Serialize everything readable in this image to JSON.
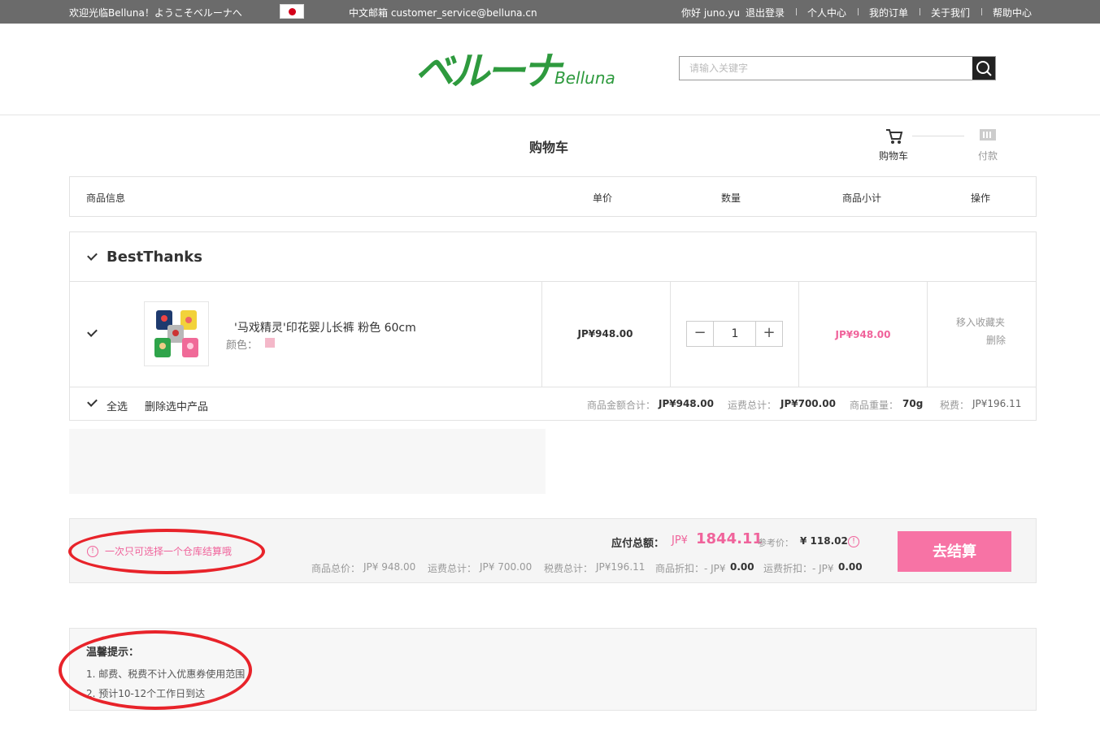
{
  "topbar": {
    "welcome": "欢迎光临Belluna！ようこそベルーナへ",
    "email": "中文邮箱 customer_service@belluna.cn",
    "greeting": "你好 juno.yu",
    "logout": "退出登录",
    "personal_center": "个人中心",
    "my_orders": "我的订单",
    "about_us": "关于我们",
    "help_center": "帮助中心"
  },
  "logo": {
    "jp": "ベルーナ",
    "en": "Belluna"
  },
  "search": {
    "placeholder": "请输入关键字"
  },
  "page_title": "购物车",
  "steps": [
    {
      "label": "购物车",
      "icon": "cart-icon"
    },
    {
      "label": "付款",
      "icon": "card-icon"
    }
  ],
  "table_headers": {
    "info": "商品信息",
    "unit_price": "单价",
    "quantity": "数量",
    "subtotal": "商品小计",
    "operation": "操作"
  },
  "shop": {
    "name": "BestThanks",
    "item": {
      "name": "'马戏精灵'印花婴儿长裤 粉色 60cm",
      "color_label": "颜色：",
      "unit_price": "JP¥948.00",
      "quantity": "1",
      "subtotal": "JP¥948.00",
      "move_to_fav": "移入收藏夹",
      "delete": "删除"
    },
    "footer": {
      "select_all": "全选",
      "delete_selected": "删除选中产品",
      "goods_total_label": "商品金额合计：",
      "goods_total": "JP¥948.00",
      "shipping_label": "运费总计：",
      "shipping": "JP¥700.00",
      "weight_label": "商品重量：",
      "weight": "70g",
      "tax_label": "税费：",
      "tax": "JP¥196.11"
    }
  },
  "summary": {
    "warning": "一次只可选择一个仓库结算哦",
    "total_label": "应付总额：",
    "total_currency": "JP¥",
    "total_value": "1844.11",
    "ref_label": "参考价：",
    "ref_value": "¥ 118.02",
    "goods_label": "商品总价：",
    "goods_value": "JP¥ 948.00",
    "ship_label": "运费总计：",
    "ship_value": "JP¥ 700.00",
    "tax_label": "税费总计：",
    "tax_value": "JP¥196.11",
    "discount_label": "商品折扣：- JP¥",
    "discount_value": "0.00",
    "ship_discount_label": "运费折扣：- JP¥",
    "ship_discount_value": "0.00",
    "checkout": "去结算"
  },
  "tips": {
    "title": "温馨提示：",
    "items": [
      "1. 邮费、税费不计入优惠券使用范围",
      "2. 预计10-12个工作日到达"
    ]
  },
  "colors": {
    "accent_pink": "#f0639b",
    "checkout_button": "#f773a5",
    "logo_green": "#2e9a3e",
    "annotation_red": "#e8232a"
  }
}
